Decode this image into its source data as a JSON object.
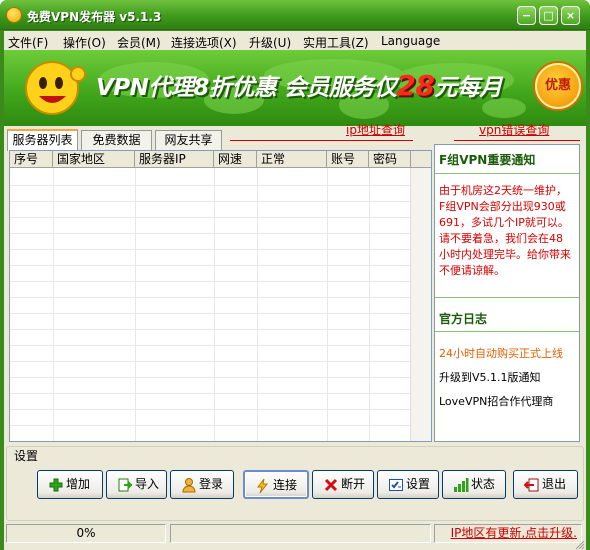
{
  "window": {
    "title": "免费VPN发布器 v5.1.3",
    "minimize_glyph": "−",
    "maximize_glyph": "□",
    "close_glyph": "×"
  },
  "menu": [
    {
      "label": "文件(F)"
    },
    {
      "label": "操作(O)"
    },
    {
      "label": "会员(M)"
    },
    {
      "label": "连接选项(X)"
    },
    {
      "label": "升级(U)"
    },
    {
      "label": "实用工具(Z)"
    },
    {
      "label": "Language"
    }
  ],
  "banner": {
    "text_main": "VPN代理8折优惠 会员服务仅",
    "price": "28",
    "text_tail": "元每月",
    "badge": "优惠"
  },
  "tabs": [
    {
      "label": "服务器列表"
    },
    {
      "label": "免费数据"
    },
    {
      "label": "网友共享"
    }
  ],
  "links": {
    "ip_lookup": "ip地址查询",
    "vpn_error": "vpn错误查询"
  },
  "table": {
    "columns": [
      "序号",
      "国家地区",
      "服务器IP",
      "网速",
      "正常",
      "账号",
      "密码"
    ]
  },
  "notice": {
    "title": "F组VPN重要通知",
    "lines": [
      "由于机房这2天统一维护，",
      "F组VPN会部分出现930或",
      "691，多试几个IP就可以。",
      "请不要着急，我们会在48",
      "小时内处理完毕。给你带来",
      "不便请谅解。"
    ]
  },
  "log": {
    "title": "官方日志",
    "items": [
      {
        "text": "24小时自动购买正式上线",
        "color": "#e06000"
      },
      {
        "text": "升级到V5.1.1版通知",
        "color": "#000000"
      },
      {
        "text": "LoveVPN招合作代理商",
        "color": "#000000"
      }
    ]
  },
  "settings": {
    "group_label": "设置",
    "buttons": [
      {
        "label": "增加",
        "icon": "plus-icon"
      },
      {
        "label": "导入",
        "icon": "import-icon"
      },
      {
        "label": "登录",
        "icon": "user-icon"
      },
      {
        "label": "连接",
        "icon": "lightning-icon"
      },
      {
        "label": "断开",
        "icon": "x-icon"
      },
      {
        "label": "设置",
        "icon": "checklist-icon"
      },
      {
        "label": "状态",
        "icon": "signal-bars-icon"
      },
      {
        "label": "退出",
        "icon": "exit-icon"
      }
    ]
  },
  "status": {
    "progress": "0%",
    "progress_value": 0,
    "update_notice": "IP地区有更新,点击升级."
  },
  "colors": {
    "title_green": "#3f9a1c",
    "banner_green": "#4fb022",
    "link_red": "#cc0000",
    "panel_heading": "#1a5c08"
  }
}
